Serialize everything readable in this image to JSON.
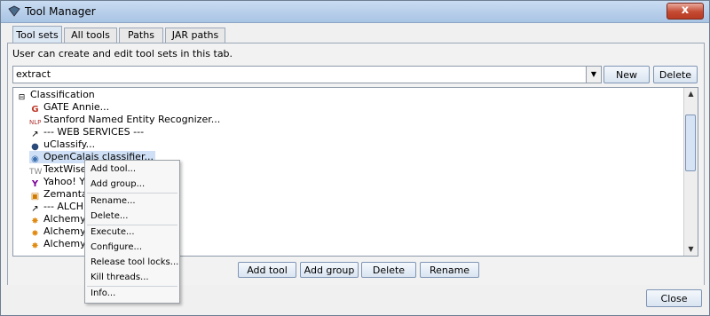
{
  "window": {
    "title": "Tool Manager",
    "close_glyph": "x"
  },
  "tabs": [
    {
      "label": "Tool sets",
      "active": true
    },
    {
      "label": "All tools"
    },
    {
      "label": "Paths"
    },
    {
      "label": "JAR paths"
    }
  ],
  "description": "User can create and edit tool sets in this tab.",
  "toolset": {
    "value": "extract",
    "new_label": "New",
    "delete_label": "Delete"
  },
  "tree": {
    "root": "Classification",
    "items": [
      {
        "label": "GATE Annie...",
        "icon": "gate-icon"
      },
      {
        "label": "Stanford Named Entity Recognizer...",
        "icon": "nlp-icon"
      },
      {
        "label": "--- WEB SERVICES ---",
        "icon": "separator-icon"
      },
      {
        "label": "uClassify...",
        "icon": "uclassify-icon"
      },
      {
        "label": "OpenCalais classifier...",
        "icon": "opencalais-icon"
      },
      {
        "label": "TextWise...",
        "icon": "textwise-icon"
      },
      {
        "label": "Yahoo! YQL...",
        "icon": "yahoo-icon"
      },
      {
        "label": "Zemanta...",
        "icon": "zemanta-icon"
      },
      {
        "label": "--- ALCHEMY ---",
        "icon": "separator-icon"
      },
      {
        "label": "Alchemy ...",
        "icon": "alchemy-icon"
      },
      {
        "label": "Alchemy ...",
        "icon": "alchemy-icon"
      },
      {
        "label": "Alchemy ...",
        "icon": "alchemy-icon"
      }
    ]
  },
  "context_menu": {
    "groups": [
      [
        "Add tool...",
        "Add group..."
      ],
      [
        "Rename...",
        "Delete..."
      ],
      [
        "Execute...",
        "Configure...",
        "Release tool locks...",
        "Kill threads..."
      ],
      [
        "Info..."
      ]
    ]
  },
  "actions": {
    "add_tool": "Add tool",
    "add_group": "Add group",
    "delete": "Delete",
    "rename": "Rename"
  },
  "footer": {
    "close": "Close"
  },
  "colors": {
    "titlebar": "#b9d1ea",
    "selection": "#cfe0f6",
    "button": "#dce7f3"
  }
}
